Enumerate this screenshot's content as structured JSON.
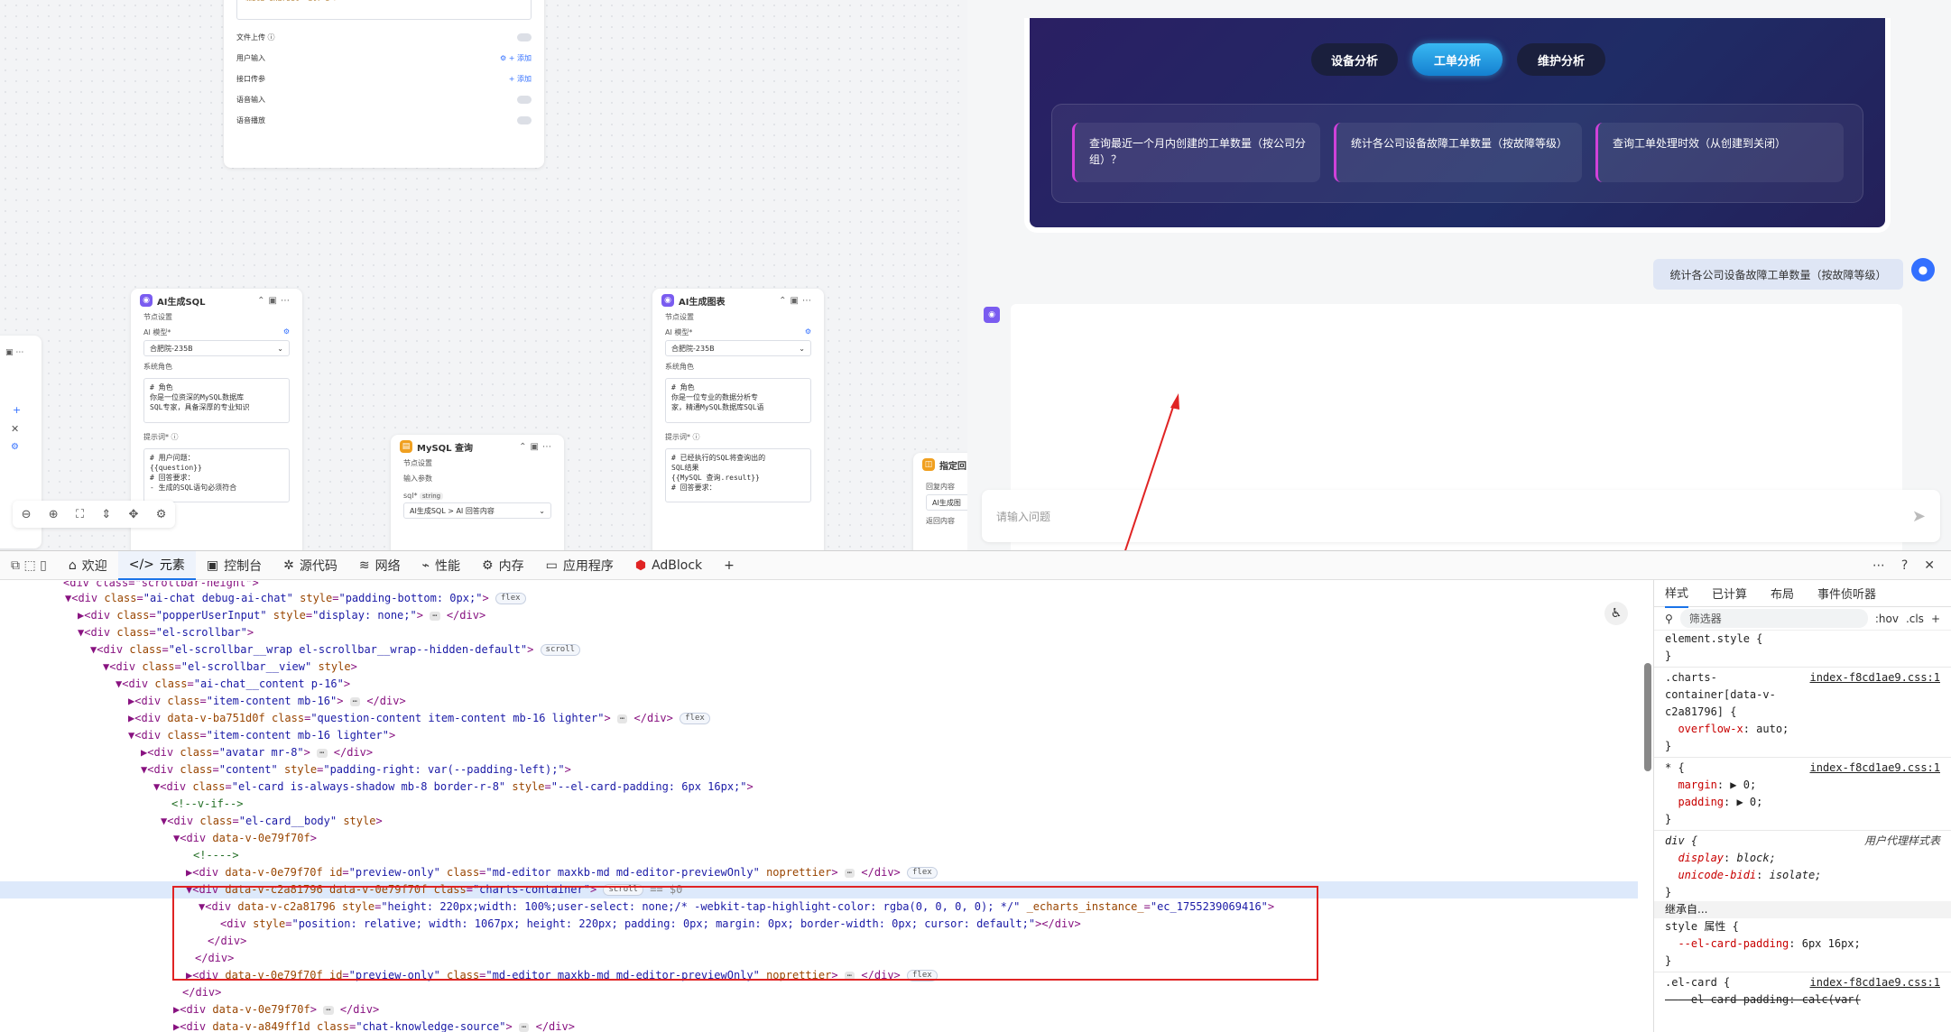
{
  "canvas": {
    "top_node": {
      "code_line": "<meta charset=\"utf-8\">",
      "rows": [
        {
          "label": "文件上传 ⓘ",
          "control": "toggle"
        },
        {
          "label": "用户输入",
          "control": "add",
          "add_label": "+ 添加"
        },
        {
          "label": "接口传参",
          "control": "add",
          "add_label": "+ 添加"
        },
        {
          "label": "语音输入",
          "control": "toggle"
        },
        {
          "label": "语音播放",
          "control": "toggle"
        }
      ]
    },
    "node_sql": {
      "title": "AI生成SQL",
      "section": "节点设置",
      "model_label": "AI 模型*",
      "model_value": "合肥院-235B",
      "role_label": "系统角色",
      "role_text": "# 角色\n你是一位资深的MySQL数据库\nSQL专家，具备深厚的专业知识",
      "prompt_label": "提示词* ⓘ",
      "prompt_text": "# 用户问题：\n{{question}}\n# 回答要求：\n- 生成的SQL语句必须符合"
    },
    "node_chart": {
      "title": "AI生成图表",
      "section": "节点设置",
      "model_label": "AI 模型*",
      "model_value": "合肥院-235B",
      "role_label": "系统角色",
      "role_text": "# 角色\n你是一位专业的数据分析专\n家，精通MySQL数据库SQL语",
      "prompt_label": "提示词* ⓘ",
      "prompt_text": "# 已经执行的SQL将查询出的\nSQL结果\n{{MySQL 查询.result}}\n# 回答要求："
    },
    "node_mysql": {
      "title": "MySQL 查询",
      "section": "节点设置",
      "params_label": "输入参数",
      "param_name": "sql*",
      "param_type": "string",
      "param_value": "AI生成SQL > AI 回答内容"
    },
    "node_reply": {
      "title": "指定回",
      "line1": "回复内容",
      "line2": "AI生成图",
      "line3": "返回内容"
    },
    "toolbar_icons": [
      "zoom-out-icon",
      "zoom-in-icon",
      "fit-view-icon",
      "collapse-icon",
      "expand-icon",
      "layout-icon"
    ]
  },
  "chat": {
    "tabs": [
      {
        "label": "设备分析",
        "active": false
      },
      {
        "label": "工单分析",
        "active": true
      },
      {
        "label": "维护分析",
        "active": false
      }
    ],
    "questions": [
      "查询最近一个月内创建的工单数量（按公司分组）？",
      "统计各公司设备故障工单数量（按故障等级）",
      "查询工单处理时效（从创建到关闭）"
    ],
    "user_question": "统计各公司设备故障工单数量（按故障等级）",
    "input_placeholder": "请输入问题"
  },
  "devtools": {
    "tabs": [
      {
        "label": "欢迎",
        "icon": "home-icon"
      },
      {
        "label": "元素",
        "icon": "code-icon",
        "active": true
      },
      {
        "label": "控制台",
        "icon": "console-icon"
      },
      {
        "label": "源代码",
        "icon": "bug-icon"
      },
      {
        "label": "网络",
        "icon": "wifi-icon"
      },
      {
        "label": "性能",
        "icon": "perf-icon"
      },
      {
        "label": "内存",
        "icon": "memory-icon"
      },
      {
        "label": "应用程序",
        "icon": "app-icon"
      },
      {
        "label": "AdBlock",
        "icon": "adblock-icon"
      }
    ],
    "side_tabs": [
      "样式",
      "已计算",
      "布局",
      "事件侦听器"
    ],
    "filter_placeholder": "筛选器",
    "filter_hov": ":hov",
    "filter_cls": ".cls",
    "styles": {
      "element_style": "element.style {",
      "rule1_selector": ".charts-\ncontainer[data-v-\nc2a81796] {",
      "rule1_src": "index-f8cd1ae9.css:1",
      "rule1_prop": "overflow-x",
      "rule1_val": "auto;",
      "rule2_selector": "* {",
      "rule2_src": "index-f8cd1ae9.css:1",
      "rule2_props": [
        [
          "margin",
          "▶ 0;"
        ],
        [
          "padding",
          "▶ 0;"
        ]
      ],
      "rule3_selector": "div {",
      "rule3_src": "用户代理样式表",
      "rule3_props": [
        [
          "display",
          "block;"
        ],
        [
          "unicode-bidi",
          "isolate;"
        ]
      ],
      "inherit_label": "继承自...",
      "style_attr": "style 属性 {",
      "style_prop": "--el-card-padding",
      "style_val": "6px 16px;",
      "rule4_selector": ".el-card {",
      "rule4_src": "index-f8cd1ae9.css:1",
      "rule4_prop": "--el-card-padding: calc(var("
    }
  }
}
